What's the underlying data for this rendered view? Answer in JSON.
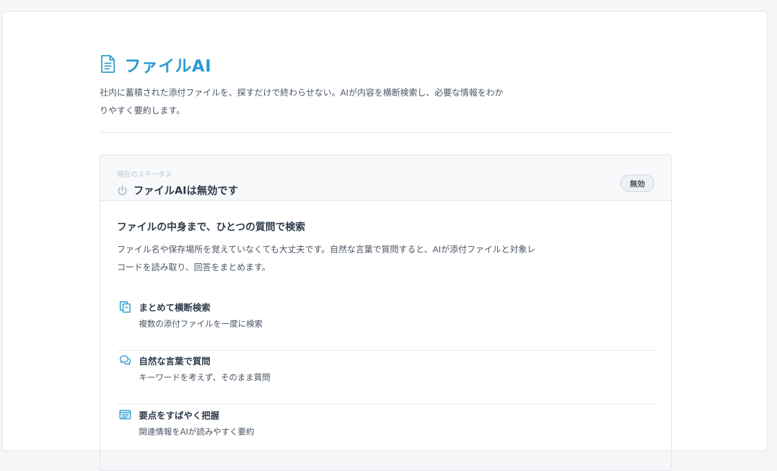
{
  "header": {
    "title": "ファイルAI",
    "title_icon": "document-icon",
    "lead_line1": "社内に蓄積された添付ファイルを、探すだけで終わらせない。AIが内容を横断検索し、必要な情報をわか",
    "lead_line2": "りやすく要約します。"
  },
  "status": {
    "caption": "現在のステータス",
    "text": "ファイルAIは無効です",
    "icon": "power-icon",
    "badge": "無効"
  },
  "intro": {
    "title": "ファイルの中身まで、ひとつの質問で検索",
    "desc_line1": "ファイル名や保存場所を覚えていなくても大丈夫です。自然な言葉で質問すると、AIが添付ファイルと対象レ",
    "desc_line2": "コードを読み取り、回答をまとめます。"
  },
  "features": [
    {
      "icon": "copy-files-icon",
      "title": "まとめて横断検索",
      "desc": "複数の添付ファイルを一度に検索"
    },
    {
      "icon": "chat-bubbles-icon",
      "title": "自然な言葉で質問",
      "desc": "キーワードを考えず、そのまま質問"
    },
    {
      "icon": "list-panel-icon",
      "title": "要点をすばやく把握",
      "desc": "関連情報をAIが読みやすく要約"
    }
  ],
  "colors": {
    "accent": "#2a9bd0",
    "heading": "#2f3b4a",
    "body_text": "#4a5563",
    "muted_caption": "#b9c6d2",
    "page_bg": "#f5f6f8",
    "border": "#e1e5ea"
  }
}
